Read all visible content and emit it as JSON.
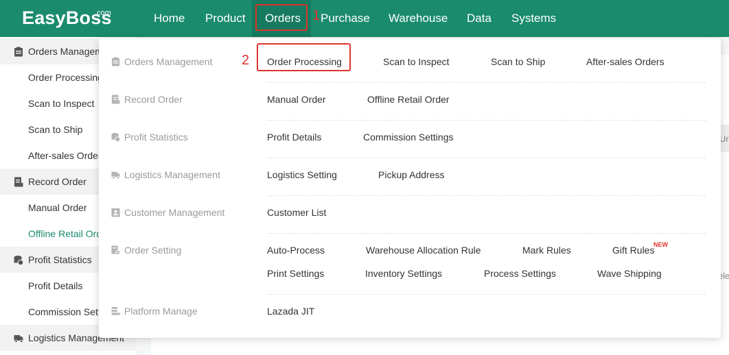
{
  "brand": {
    "logo": "EasyBoss",
    "suffix": ".com"
  },
  "nav": {
    "items": [
      {
        "label": "Home"
      },
      {
        "label": "Product"
      },
      {
        "label": "Orders"
      },
      {
        "label": "Purchase"
      },
      {
        "label": "Warehouse"
      },
      {
        "label": "Data"
      },
      {
        "label": "Systems"
      }
    ],
    "active": "Orders"
  },
  "annotations": {
    "step1": "1",
    "step2": "2"
  },
  "sidebar": {
    "groups": [
      {
        "label": "Orders Management",
        "icon": "clipboard-icon"
      },
      {
        "label": "Record Order",
        "icon": "document-icon"
      },
      {
        "label": "Profit Statistics",
        "icon": "coins-icon"
      },
      {
        "label": "Logistics Management",
        "icon": "truck-icon"
      }
    ],
    "subs": [
      {
        "label": "Order Processing"
      },
      {
        "label": "Scan to Inspect"
      },
      {
        "label": "Scan to Ship"
      },
      {
        "label": "After-sales Orders"
      },
      {
        "label": "Manual Order"
      },
      {
        "label": "Offline Retail Order"
      },
      {
        "label": "Profit Details"
      },
      {
        "label": "Commission Settings"
      }
    ]
  },
  "menu": {
    "categories": [
      {
        "label": "Orders Management",
        "icon": "clipboard-icon"
      },
      {
        "label": "Record Order",
        "icon": "document-icon"
      },
      {
        "label": "Profit Statistics",
        "icon": "coins-icon"
      },
      {
        "label": "Logistics Management",
        "icon": "truck-icon"
      },
      {
        "label": "Customer Management",
        "icon": "contact-card-icon"
      },
      {
        "label": "Order Setting",
        "icon": "settings-doc-icon"
      },
      {
        "label": "Platform Manage",
        "icon": "stack-icon"
      }
    ],
    "links": {
      "order_processing": "Order Processing",
      "scan_to_inspect": "Scan to Inspect",
      "scan_to_ship": "Scan to Ship",
      "after_sales_orders": "After-sales Orders",
      "manual_order": "Manual Order",
      "offline_retail_order": "Offline Retail Order",
      "profit_details": "Profit Details",
      "commission_settings": "Commission Settings",
      "logistics_setting": "Logistics Setting",
      "pickup_address": "Pickup Address",
      "customer_list": "Customer List",
      "auto_process": "Auto-Process",
      "warehouse_allocation_rule": "Warehouse Allocation Rule",
      "mark_rules": "Mark Rules",
      "gift_rules": "Gift Rules",
      "print_settings": "Print Settings",
      "inventory_settings": "Inventory Settings",
      "process_settings": "Process Settings",
      "wave_shipping": "Wave Shipping",
      "lazada_jit": "Lazada JIT"
    },
    "new_badge": "NEW"
  },
  "background": {
    "edge_text_1": "Ur",
    "edge_text_2": "ele"
  },
  "colors": {
    "brand": "#1a8b6d",
    "highlight": "#e0322b"
  }
}
